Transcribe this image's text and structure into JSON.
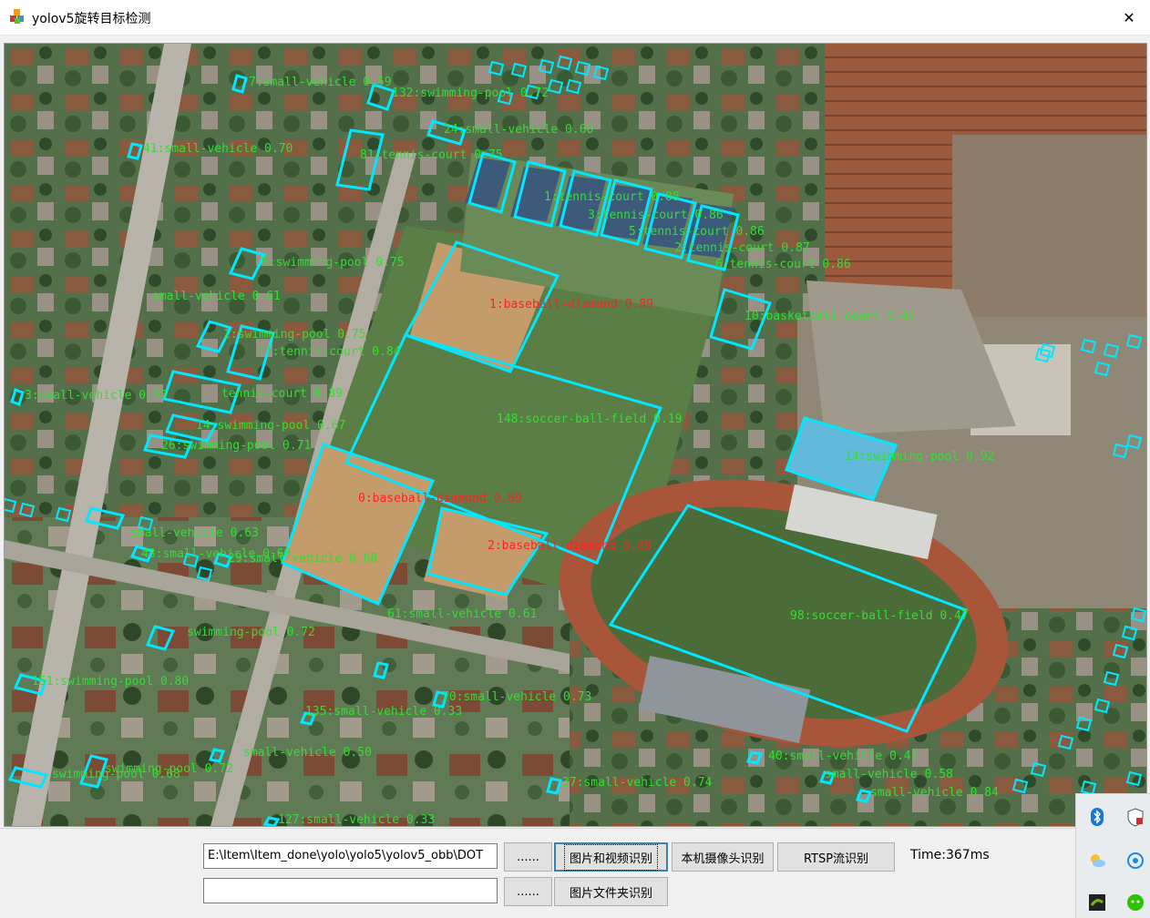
{
  "window": {
    "title": "yolov5旋转目标检测",
    "close_glyph": "✕",
    "app_icon": "colored-cubes-icon"
  },
  "colors": {
    "box": "#00e8ff",
    "label": "#33dd33",
    "label_red": "#ff2222"
  },
  "detections": [
    {
      "text": "7:small-vehicle 0.59"
    },
    {
      "text": "132:swimming-pool 0.72"
    },
    {
      "text": "41:small-vehicle 0.70"
    },
    {
      "text": "24:small-vehicle 0.60"
    },
    {
      "text": "81:tennis-court 0.75"
    },
    {
      "text": "1:tennis-court 0.88"
    },
    {
      "text": "3:tennis-court 0.86"
    },
    {
      "text": "5:tennis-court 0.86"
    },
    {
      "text": "2:tennis-court 0.87"
    },
    {
      "text": "6:tennis-court 0.86"
    },
    {
      "text": "5:swimming-pool 0.75"
    },
    {
      "text": "small-vehicle 0.61"
    },
    {
      "text": "1:baseball-diamond 0.89"
    },
    {
      "text": "1:swimming-pool 0.75"
    },
    {
      "text": "11:tennis-court 0.84"
    },
    {
      "text": "10:basketball-court 0.47"
    },
    {
      "text": "3:small-vehicle 0.57"
    },
    {
      "text": "tennis-court 0.89"
    },
    {
      "text": "148:soccer-ball-field 0.19"
    },
    {
      "text": "14:swimming-pool 0.67"
    },
    {
      "text": "26:swimming-pool 0.71"
    },
    {
      "text": "14:swimming-pool 0.92"
    },
    {
      "text": "0:baseball-diamond 0.89"
    },
    {
      "text": "small-vehicle 0.63"
    },
    {
      "text": "2:baseball-diamond 0.89"
    },
    {
      "text": "43:small-vehicle 0.68"
    },
    {
      "text": "29:small-vehicle 0.68"
    },
    {
      "text": "98:soccer-ball-field 0.47"
    },
    {
      "text": "swimming-pool 0.72"
    },
    {
      "text": "61:small-vehicle 0.61"
    },
    {
      "text": "151:swimming-pool 0.80"
    },
    {
      "text": "70:small-vehicle 0.73"
    },
    {
      "text": "135:small-vehicle 0.33"
    },
    {
      "text": "swimming-pool 0.72"
    },
    {
      "text": "small-vehicle 0.50"
    },
    {
      "text": "swimming-pool 0.68"
    },
    {
      "text": "37:small-vehicle 0.74"
    },
    {
      "text": "127:small-vehicle 0.33"
    },
    {
      "text": "40:small-vehicle 0.41"
    },
    {
      "text": "small-vehicle 0.58"
    },
    {
      "text": "small-vehicle 0.84"
    }
  ],
  "controls": {
    "path_value": "E:\\Item\\Item_done\\yolo\\yolo5\\yolov5_obb\\DOT",
    "path2_value": "",
    "browse_label": "......",
    "browse2_label": "......",
    "image_video_btn": "图片和视频识别",
    "camera_btn": "本机摄像头识别",
    "rtsp_btn": "RTSP流识别",
    "folder_btn": "图片文件夹识别",
    "time_label": "Time:367ms"
  },
  "tray": {
    "icons": [
      "bluetooth-icon",
      "security-shield-icon",
      "weather-icon",
      "network-app-icon",
      "nvidia-icon",
      "wechat-icon"
    ]
  }
}
